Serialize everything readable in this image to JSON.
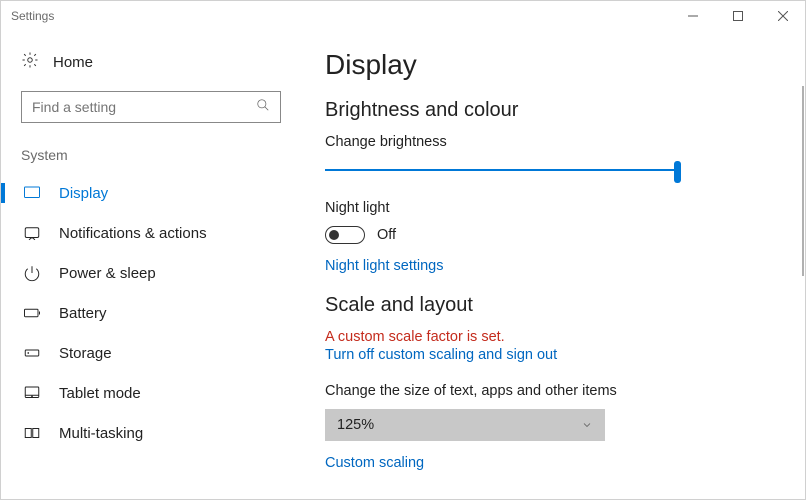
{
  "window": {
    "title": "Settings"
  },
  "sidebar": {
    "home_label": "Home",
    "search_placeholder": "Find a setting",
    "section_label": "System",
    "items": [
      {
        "label": "Display",
        "active": true
      },
      {
        "label": "Notifications & actions"
      },
      {
        "label": "Power & sleep"
      },
      {
        "label": "Battery"
      },
      {
        "label": "Storage"
      },
      {
        "label": "Tablet mode"
      },
      {
        "label": "Multi-tasking"
      }
    ]
  },
  "main": {
    "title": "Display",
    "section_brightness": "Brightness and colour",
    "brightness_label": "Change brightness",
    "night_light_label": "Night light",
    "night_light_state": "Off",
    "night_light_link": "Night light settings",
    "section_scale": "Scale and layout",
    "scale_warn": "A custom scale factor is set.",
    "scale_link": "Turn off custom scaling and sign out",
    "scale_dropdown_label": "Change the size of text, apps and other items",
    "scale_value": "125%",
    "custom_scaling_link": "Custom scaling"
  }
}
